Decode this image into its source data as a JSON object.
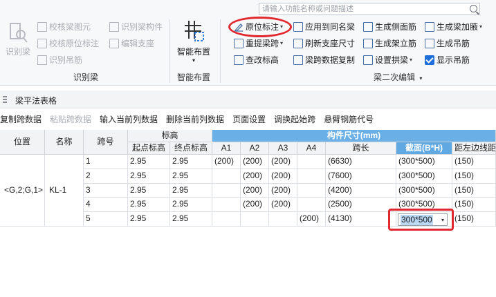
{
  "search": {
    "placeholder": "请输入功能名称或问题描述"
  },
  "ribbon": {
    "identify_group": {
      "label": "识别梁",
      "big_button": "识别梁",
      "items": [
        "校核梁图元",
        "识别梁构件",
        "校核原位标注",
        "编辑支座",
        "识别吊筋"
      ]
    },
    "smart_group": {
      "label": "智能布置",
      "big_button": "智能布置",
      "caret": "▾"
    },
    "edit_group": {
      "label": "梁二次编辑",
      "label_caret": "▾",
      "items": [
        {
          "label": "原位标注",
          "caret": "▾"
        },
        {
          "label": "应用到同名梁",
          "caret": ""
        },
        {
          "label": "生成侧面筋",
          "caret": ""
        },
        {
          "label": "生成梁加腋",
          "caret": "▾"
        },
        {
          "label": "重提梁跨",
          "caret": "▾"
        },
        {
          "label": "刷新支座尺寸",
          "caret": ""
        },
        {
          "label": "生成架立筋",
          "caret": ""
        },
        {
          "label": "生成吊筋",
          "caret": ""
        },
        {
          "label": "查改标高",
          "caret": ""
        },
        {
          "label": "梁跨数据复制",
          "caret": ""
        },
        {
          "label": "设置拱梁",
          "caret": "▾"
        },
        {
          "label": "显示吊筋",
          "caret": ""
        }
      ]
    }
  },
  "panel": {
    "title": "梁平法表格"
  },
  "toolbar": [
    "复制跨数据",
    "粘贴跨数据",
    "输入当前列数据",
    "删除当前列数据",
    "页面设置",
    "调换起始跨",
    "悬臂钢筋代号"
  ],
  "table": {
    "headers": {
      "position": "位置",
      "name": "名称",
      "span_no": "跨号",
      "elevation": "标高",
      "start_elev": "起点标高",
      "end_elev": "终点标高",
      "dimensions": "构件尺寸(mm)",
      "a1": "A1",
      "a2": "A2",
      "a3": "A3",
      "a4": "A4",
      "span_length": "跨长",
      "section": "截面(B*H)",
      "edge_dist": "距左边线距"
    },
    "position_value": "<G,2;G,1>",
    "name_value": "KL-1",
    "rows": [
      {
        "span": "1",
        "start": "2.95",
        "end": "2.95",
        "a1": "(200)",
        "a2": "(200)",
        "a3": "(200)",
        "a4": "",
        "length": "(6630)",
        "section": "(300*500)",
        "edge": "(150)"
      },
      {
        "span": "2",
        "start": "2.95",
        "end": "2.95",
        "a1": "",
        "a2": "(200)",
        "a3": "(200)",
        "a4": "",
        "length": "(7600)",
        "section": "(300*500)",
        "edge": "(150)"
      },
      {
        "span": "3",
        "start": "2.95",
        "end": "2.95",
        "a1": "",
        "a2": "(200)",
        "a3": "(200)",
        "a4": "",
        "length": "(4200)",
        "section": "(300*500)",
        "edge": "(150)"
      },
      {
        "span": "4",
        "start": "2.95",
        "end": "2.95",
        "a1": "",
        "a2": "(200)",
        "a3": "(200)",
        "a4": "",
        "length": "(2500)",
        "section": "(300*500)",
        "edge": "(150)"
      },
      {
        "span": "5",
        "start": "2.95",
        "end": "2.95",
        "a1": "",
        "a2": "",
        "a3": "",
        "a4": "(200)",
        "length": "(4130)",
        "section": "",
        "edge": "(150)"
      }
    ],
    "editing_value": "300*500",
    "editing_caret": "▾"
  },
  "colors": {
    "accent": "#1e6fd9",
    "header_blue": "#6ab0e6",
    "highlight": "#e0282e"
  }
}
